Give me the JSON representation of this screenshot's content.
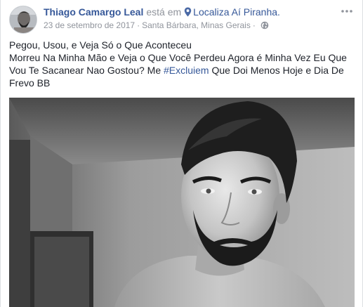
{
  "post": {
    "author": "Thiago Camargo Leal",
    "is_at": "está em",
    "place": "Localiza Aí Piranha.",
    "date": "23 de setembro de 2017",
    "separator": "·",
    "location": "Santa Bárbara, Minas Gerais",
    "text_line1": "Pegou, Usou, e Veja Só o Que Aconteceu",
    "text_line2": "Morreu Na Minha Mão e Veja o Que Você Perdeu Agora é Minha Vez Eu Que",
    "text_line3_a": "Vou Te Sacanear Nao Gostou? Me",
    "hashtag": "#Excluiem",
    "text_line3_b": "Que Doi Menos Hoje e Dia De",
    "text_line4": "Frevo BB"
  },
  "icons": {
    "pin": "map-pin-icon",
    "globe": "globe-icon",
    "more": "more-options-icon"
  },
  "colors": {
    "link": "#365899",
    "meta": "#90949c",
    "text": "#1d2129"
  }
}
